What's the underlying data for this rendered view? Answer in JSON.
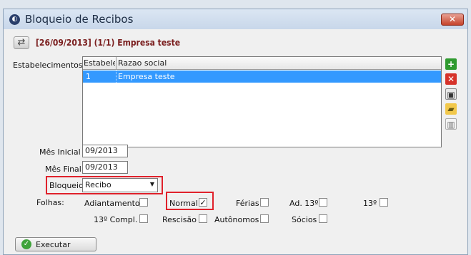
{
  "window": {
    "title": "Bloqueio de Recibos",
    "close_icon": "✕"
  },
  "header": {
    "text": "[26/09/2013] (1/1) Empresa teste"
  },
  "estabelecimentos": {
    "label": "Estabelecimentos",
    "columns": [
      "Estabelecimento",
      "Razao social"
    ],
    "rows": [
      {
        "code": "1",
        "name": "Empresa teste"
      }
    ]
  },
  "side_buttons": [
    "add",
    "remove",
    "save",
    "open",
    "delete"
  ],
  "fields": {
    "mes_inicial": {
      "label": "Mês Inicial",
      "value": "09/2013"
    },
    "mes_final": {
      "label": "Mês Final",
      "value": "09/2013"
    },
    "bloqueio": {
      "label": "Bloqueio",
      "value": "Recibo"
    }
  },
  "folhas": {
    "label": "Folhas:",
    "items": [
      {
        "label": "Adiantamento",
        "checked": false
      },
      {
        "label": "Normal",
        "checked": true
      },
      {
        "label": "Férias",
        "checked": false
      },
      {
        "label": "Ad. 13º",
        "checked": false
      },
      {
        "label": "13º",
        "checked": false
      },
      {
        "label": "13º Compl.",
        "checked": false
      },
      {
        "label": "Rescisão",
        "checked": false
      },
      {
        "label": "Autônomos",
        "checked": false
      },
      {
        "label": "Sócios",
        "checked": false
      }
    ]
  },
  "actions": {
    "execute_label": "Executar"
  },
  "colors": {
    "selected_row": "#3399ff",
    "highlight": "#e0212b",
    "header_text": "#7a1e1e"
  }
}
